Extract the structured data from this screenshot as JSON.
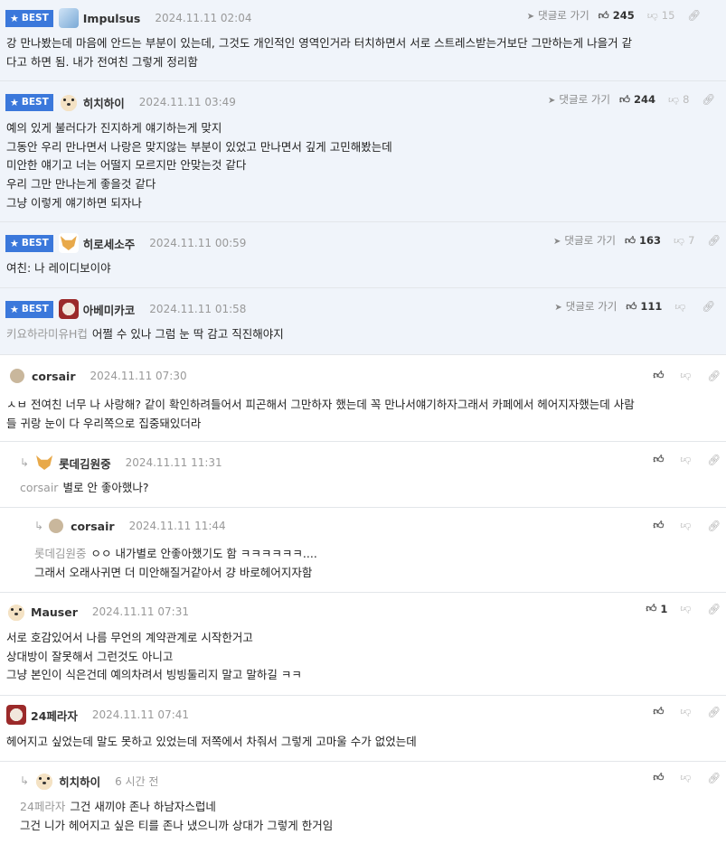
{
  "labels": {
    "best": "BEST",
    "reply_goto": "댓글로 가기"
  },
  "comments": [
    {
      "nick": "Impulsus",
      "date": "2024.11.11 02:04",
      "up": "245",
      "down": "15",
      "lines": [
        "강 만나봤는데 마음에 안드는 부분이 있는데, 그것도 개인적인 영역인거라 터치하면서 서로 스트레스받는거보단 그만하는게 나을거 같",
        "다고 하면 됨. 내가 전여친 그렇게 정리함"
      ]
    },
    {
      "nick": "히치하이",
      "date": "2024.11.11 03:49",
      "up": "244",
      "down": "8",
      "lines": [
        "예의 있게 불러다가 진지하게 얘기하는게 맞지",
        "그동안 우리 만나면서 나랑은 맞지않는 부분이 있었고 만나면서 깊게 고민해봤는데",
        "미안한 얘기고 너는 어떨지 모르지만 안맞는것 같다",
        "우리 그만 만나는게 좋을것 같다",
        "그냥 이렇게 얘기하면 되자나"
      ]
    },
    {
      "nick": "히로세소주",
      "date": "2024.11.11 00:59",
      "up": "163",
      "down": "7",
      "lines": [
        "여친: 나 레이디보이야"
      ]
    },
    {
      "nick": "아베미카코",
      "date": "2024.11.11 01:58",
      "up": "111",
      "down": "",
      "mention": "키요하라미유H컵",
      "lines": [
        "어쩔 수 있나 그럼 눈 딱 감고 직진해야지"
      ]
    },
    {
      "nick": "corsair",
      "date": "2024.11.11 07:30",
      "up": "",
      "lines": [
        "ㅅㅂ 전여친 너무 나 사랑해? 같이 확인하려들어서 피곤해서 그만하자 했는데 꼭 만나서얘기하자그래서 카페에서 헤어지자했는데 사람",
        "들 귀랑 눈이 다 우리쪽으로 집중돼있더라"
      ]
    },
    {
      "nick": "롯데김원중",
      "date": "2024.11.11 11:31",
      "up": "",
      "mention": "corsair",
      "lines": [
        "별로 안 좋아했나?"
      ]
    },
    {
      "nick": "corsair",
      "date": "2024.11.11 11:44",
      "up": "",
      "mention": "롯데김원중",
      "lines": [
        "ㅇㅇ 내가별로 안좋아했기도 함 ㅋㅋㅋㅋㅋㅋ....",
        "그래서 오래사귀면 더 미안해질거같아서 걍 바로헤어지자함"
      ]
    },
    {
      "nick": "Mauser",
      "date": "2024.11.11 07:31",
      "up": "1",
      "lines": [
        "서로 호감있어서 나름 무언의 계약관계로 시작한거고",
        "상대방이 잘못해서 그런것도 아니고",
        "그냥 본인이 식은건데 예의차려서 빙빙둘리지 말고 말하길 ㅋㅋ"
      ]
    },
    {
      "nick": "24페라자",
      "date": "2024.11.11 07:41",
      "up": "",
      "lines": [
        "헤어지고 싶었는데 말도 못하고 있었는데 저쪽에서 차줘서 그렇게 고마울 수가 없었는데"
      ]
    },
    {
      "nick": "히치하이",
      "date": "6 시간 전",
      "up": "",
      "mention": "24페라자",
      "lines": [
        "그건 새끼야 존나 하남자스럽네",
        "그건 니가 헤어지고 싶은 티를 존나 냈으니까 상대가 그렇게 한거임"
      ]
    }
  ]
}
